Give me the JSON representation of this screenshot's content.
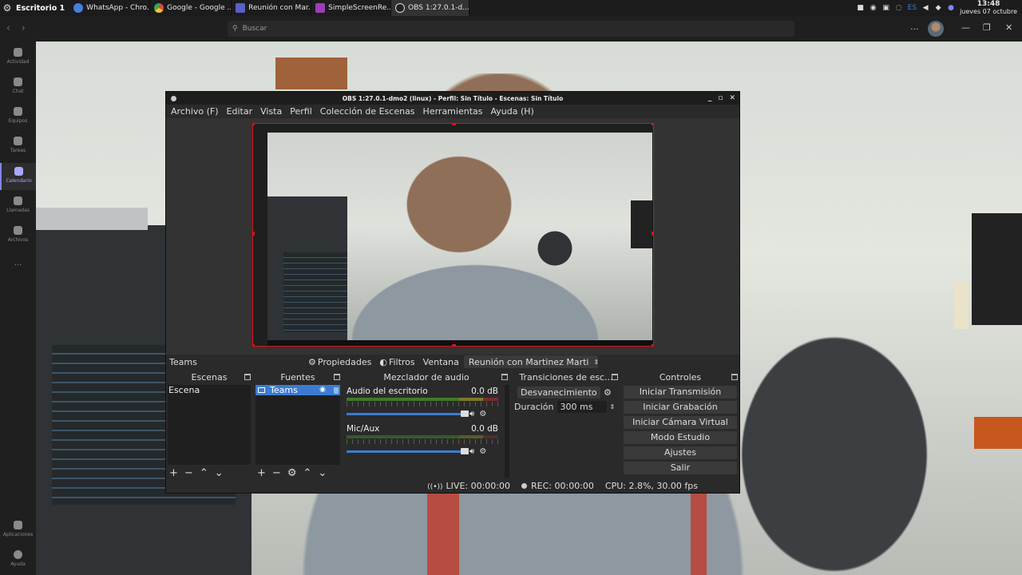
{
  "taskbar": {
    "workspace": "Escritorio 1",
    "tasks": [
      {
        "label": "WhatsApp - Chro...",
        "color": "#4a7ed9"
      },
      {
        "label": "Google - Google ...",
        "color": "#e8a33a"
      },
      {
        "label": "Reunión con Mar...",
        "color": "#5b5fc7"
      },
      {
        "label": "SimpleScreenRe...",
        "color": "#9b3fb5"
      },
      {
        "label": "OBS 1:27.0.1-d...",
        "color": "#444444"
      }
    ],
    "tray_lang": "ES",
    "clock_time": "13:48",
    "clock_date": "jueves 07 octubre"
  },
  "teams": {
    "search_placeholder": "Buscar",
    "rail": [
      {
        "label": "Actividad",
        "icon": "bell-icon"
      },
      {
        "label": "Chat",
        "icon": "chat-icon"
      },
      {
        "label": "Equipos",
        "icon": "teams-icon"
      },
      {
        "label": "Tareas",
        "icon": "tasks-icon"
      },
      {
        "label": "Calendario",
        "icon": "calendar-icon"
      },
      {
        "label": "Llamadas",
        "icon": "phone-icon"
      },
      {
        "label": "Archivos",
        "icon": "file-icon"
      },
      {
        "label": "Aplicaciones",
        "icon": "apps-icon"
      },
      {
        "label": "Ayuda",
        "icon": "help-icon"
      }
    ],
    "more": "..."
  },
  "obs": {
    "title": "OBS 1:27.0.1-dmo2 (linux) - Perfil: Sin Título - Escenas: Sin Título",
    "menu": [
      "Archivo (F)",
      "Editar",
      "Vista",
      "Perfil",
      "Colección de Escenas",
      "Herramientas",
      "Ayuda (H)"
    ],
    "source_toolbar": {
      "source_name": "Teams",
      "properties": "Propiedades",
      "filters": "Filtros",
      "window_label": "Ventana",
      "window_value": "Reunión con Martinez Marti"
    },
    "docks": {
      "scenes": {
        "title": "Escenas",
        "items": [
          "Escena"
        ]
      },
      "sources": {
        "title": "Fuentes",
        "items": [
          "Teams"
        ]
      },
      "mixer": {
        "title": "Mezclador de audio",
        "channels": [
          {
            "name": "Audio del escritorio",
            "level": "0.0 dB"
          },
          {
            "name": "Mic/Aux",
            "level": "0.0 dB"
          }
        ]
      },
      "transitions": {
        "title": "Transiciones de esc...",
        "selected": "Desvanecimiento",
        "duration_label": "Duración",
        "duration_value": "300 ms"
      },
      "controls": {
        "title": "Controles",
        "buttons": [
          "Iniciar Transmisión",
          "Iniciar Grabación",
          "Iniciar Cámara Virtual",
          "Modo Estudio",
          "Ajustes",
          "Salir"
        ]
      }
    },
    "status": {
      "live": "LIVE: 00:00:00",
      "rec": "REC: 00:00:00",
      "cpu": "CPU: 2.8%, 30.00 fps"
    }
  }
}
